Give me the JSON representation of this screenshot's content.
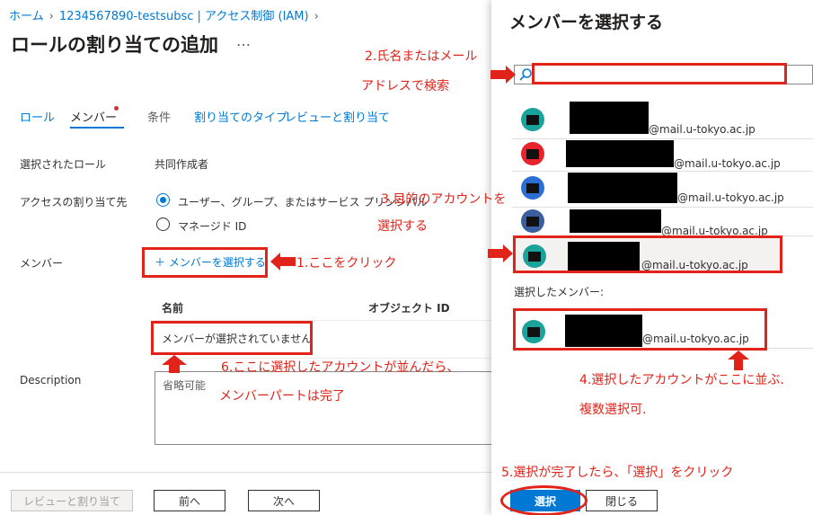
{
  "breadcrumb": {
    "home": "ホーム",
    "subscription": "1234567890-testsubsc | アクセス制御 (IAM)"
  },
  "page": {
    "title": "ロールの割り当ての追加",
    "more": "…"
  },
  "tabs": [
    {
      "label": "ロール"
    },
    {
      "label": "メンバー"
    },
    {
      "label": "条件"
    },
    {
      "label": "割り当てのタイプ"
    },
    {
      "label": "レビューと割り当て"
    }
  ],
  "form": {
    "selected_role_label": "選択されたロール",
    "selected_role_value": "共同作成者",
    "assign_access_label": "アクセスの割り当て先",
    "option_user": "ユーザー、グループ、またはサービス プリンシパル",
    "option_managed": "マネージド ID",
    "members_label": "メンバー",
    "select_members_link": "メンバーを選択する",
    "col_name": "名前",
    "col_object_id": "オブジェクト ID",
    "no_members": "メンバーが選択されていません",
    "description_label": "Description",
    "description_placeholder": "省略可能"
  },
  "footer": {
    "review_assign": "レビューと割り当て",
    "prev": "前へ",
    "next": "次へ"
  },
  "panel": {
    "title": "メンバーを選択する",
    "search_value": "",
    "members": [
      {
        "email": "@mail.u-tokyo.ac.jp",
        "avatar_color": "#1aa39a"
      },
      {
        "email": "@mail.u-tokyo.ac.jp",
        "avatar_color": "#e8232b"
      },
      {
        "email": "@mail.u-tokyo.ac.jp",
        "avatar_color": "#2b6fd6"
      },
      {
        "email": "@mail.u-tokyo.ac.jp",
        "avatar_color": "#3a5e9e"
      },
      {
        "email": "@mail.u-tokyo.ac.jp",
        "avatar_color": "#1aa39a"
      }
    ],
    "selected_label": "選択したメンバー:",
    "selected_member": {
      "email": "@mail.u-tokyo.ac.jp",
      "avatar_color": "#1aa39a"
    },
    "select_button": "選択",
    "close_button": "閉じる"
  },
  "annotations": {
    "step1": "1.ここをクリック",
    "step2_line1": "2.氏名またはメール",
    "step2_line2": "アドレスで検索",
    "step3_line1": "3.目的のアカウントを",
    "step3_line2": "選択する",
    "step4_line1": "4.選択したアカウントがここに並ぶ.",
    "step4_line2": "複数選択可.",
    "step5": "5.選択が完了したら、「選択」をクリック",
    "step6_line1": "6.ここに選択したアカウントが並んだら、",
    "step6_line2": "メンバーパートは完了"
  },
  "colors": {
    "accent": "#0078d4",
    "annotation_red": "#e2231a"
  }
}
